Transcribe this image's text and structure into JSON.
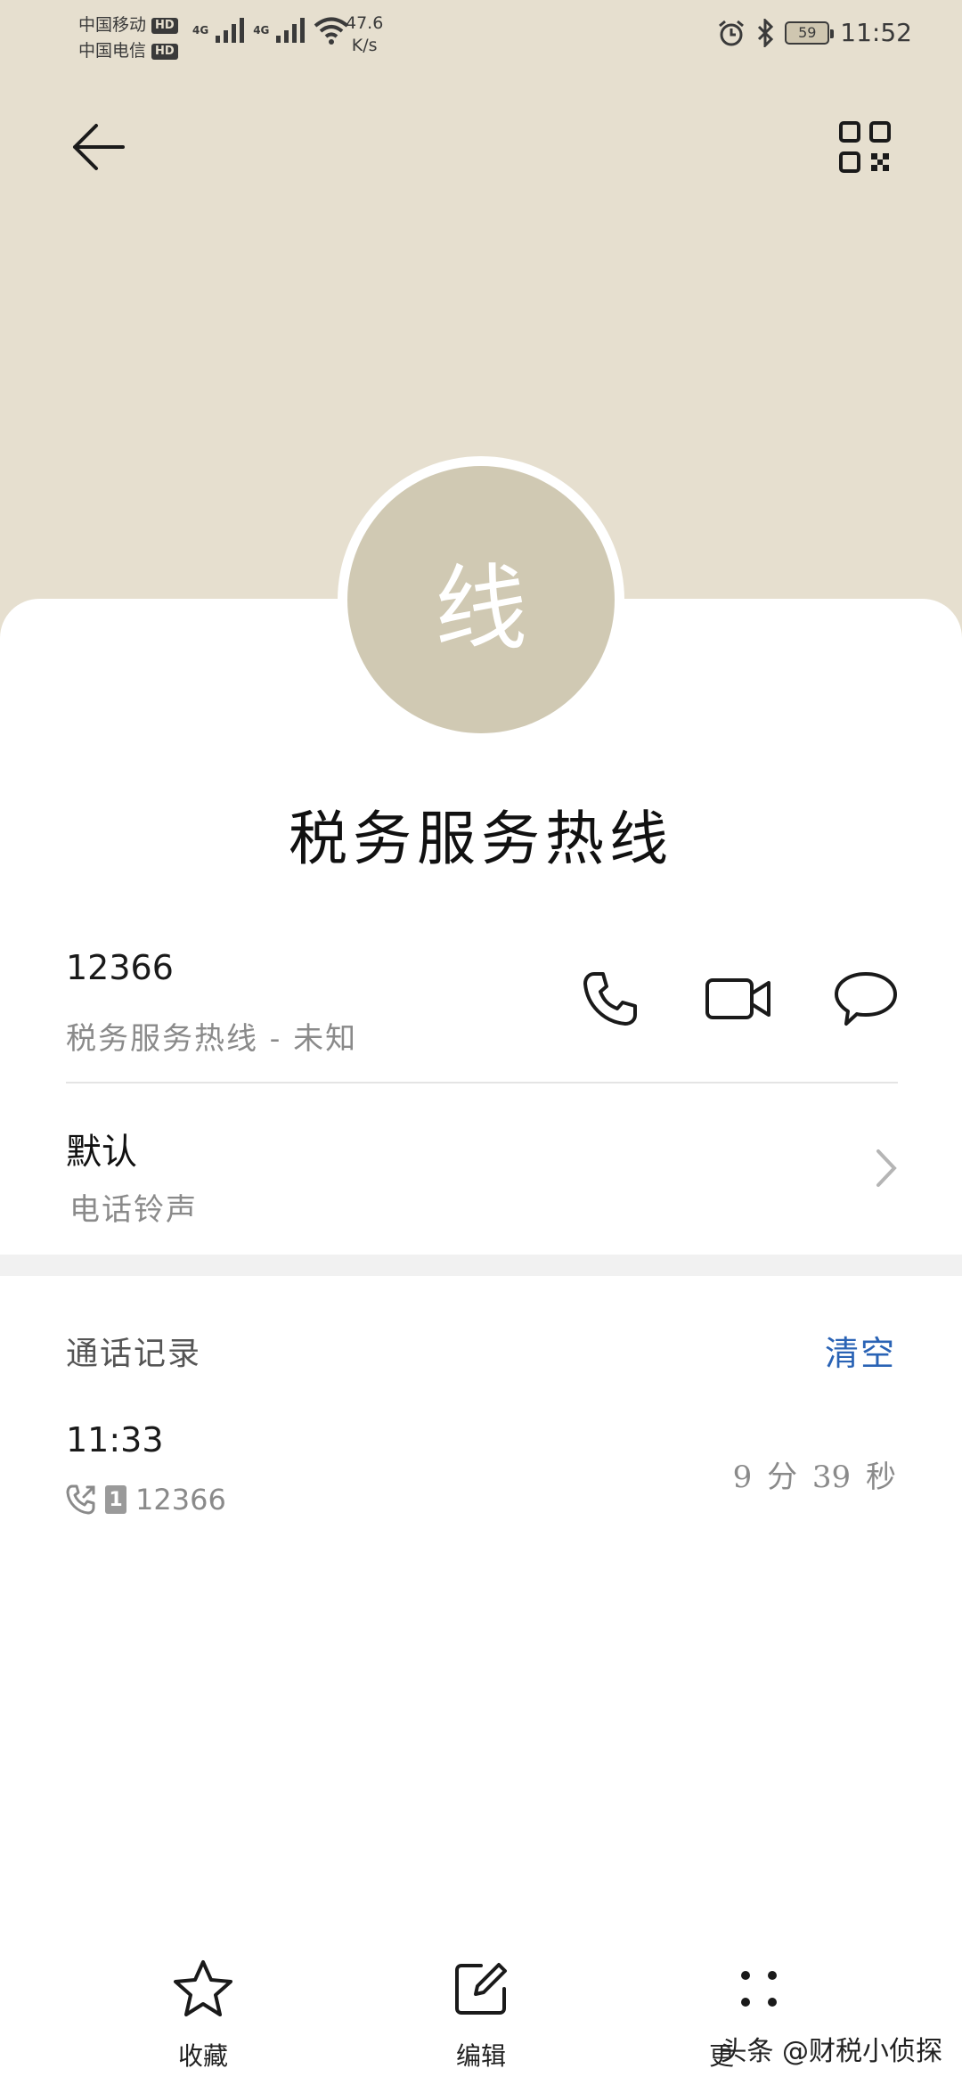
{
  "status_bar": {
    "carrier_1": "中国移动",
    "carrier_2": "中国电信",
    "hd_badge": "HD",
    "network": "4G",
    "speed_value": "47.6",
    "speed_unit": "K/s",
    "battery": "59",
    "time": "11:52"
  },
  "contact": {
    "avatar_text": "线",
    "name": "税务服务热线",
    "number": "12366",
    "number_label": "税务服务热线 - 未知"
  },
  "ringtone": {
    "value": "默认",
    "label": "电话铃声"
  },
  "call_log": {
    "title": "通话记录",
    "clear_label": "清空",
    "entries": [
      {
        "time": "11:33",
        "sim": "1",
        "number": "12366",
        "duration": "9 分 39 秒"
      }
    ]
  },
  "bottom_bar": {
    "favorite_label": "收藏",
    "edit_label": "编辑",
    "more_label": "更"
  },
  "watermark": "头条 @财税小侦探",
  "colors": {
    "header_bg": "#e6dfcf",
    "avatar_bg": "#d0c9b3",
    "accent_link": "#2a63b5"
  }
}
